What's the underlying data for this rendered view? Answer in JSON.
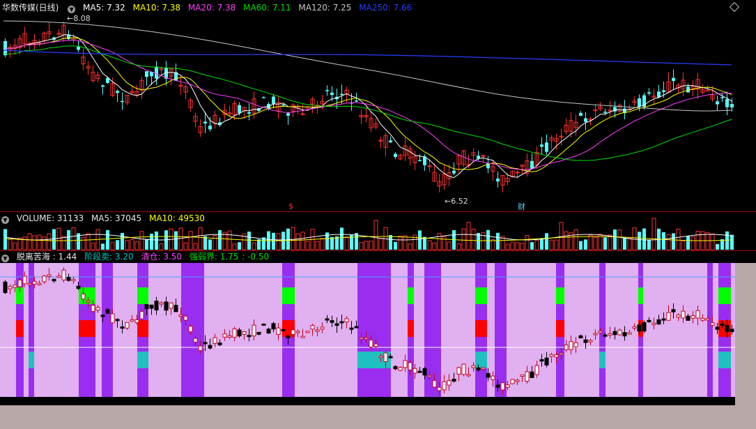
{
  "price_panel": {
    "title": "华数传媒(日线)",
    "ma": [
      {
        "label": "MA5: 7.32",
        "color": "#ffffff"
      },
      {
        "label": "MA10: 7.38",
        "color": "#ffff00"
      },
      {
        "label": "MA20: 7.38",
        "color": "#ff40ff"
      },
      {
        "label": "MA60: 7.11",
        "color": "#00e000"
      },
      {
        "label": "MA120: 7.25",
        "color": "#c8c8c8"
      },
      {
        "label": "MA250: 7.66",
        "color": "#2a3cff"
      }
    ],
    "high_label": "8.08",
    "low_label": "6.52",
    "event_mark_1": "$",
    "event_mark_2": "财"
  },
  "volume_panel": {
    "title": "VOLUME: 31133",
    "ma5": "MA5: 37045",
    "ma10": "MA10: 49530"
  },
  "indicator_panel": {
    "title": "脱离苦海 : 1.44",
    "stage_sell": "阶段卖: 3.20",
    "clear": "清仓: 3.50",
    "strength": "强弱界: 1.75",
    "last": ": -0.50"
  },
  "colors": {
    "up": "#ff3030",
    "down": "#54ffff",
    "ma5": "#ffffff",
    "ma10": "#ffff00",
    "ma20": "#ff40ff",
    "ma60": "#00e000",
    "ma120": "#c8c8c8",
    "ma250": "#2a3cff",
    "indicator_bg": "#e0b0f0",
    "indicator_violet": "#9a2ef0",
    "indicator_green": "#00ff00",
    "indicator_red": "#ff0000",
    "indicator_teal": "#20c0c0"
  }
}
